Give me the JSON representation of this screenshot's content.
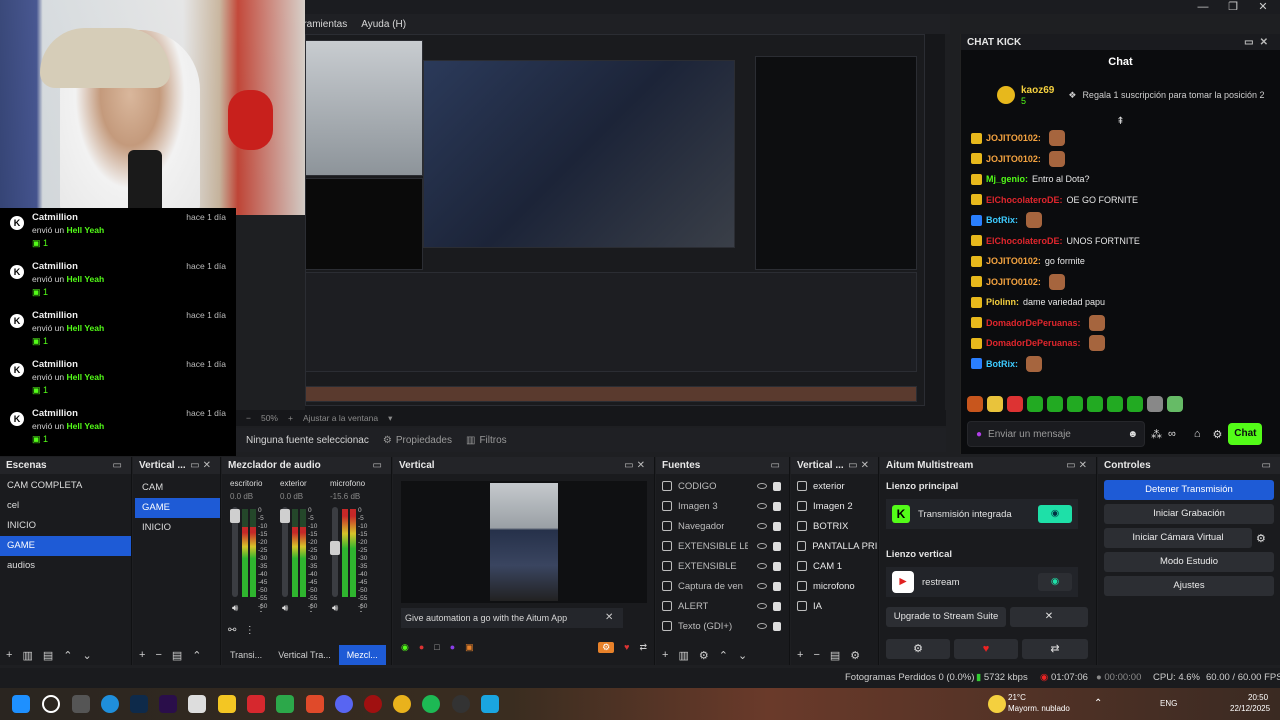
{
  "menu": {
    "tools": "rramientas",
    "help": "Ayuda (H)"
  },
  "window_controls": [
    "—",
    "❐",
    "✕"
  ],
  "preview": {
    "zoom": "50%",
    "fit": "Ajustar a la ventana",
    "no_source": "Ninguna fuente seleccionac",
    "properties": "Propiedades",
    "filters": "Filtros"
  },
  "feed": {
    "items": [
      {
        "name": "Catmillion",
        "time": "hace 1 día",
        "text": "envió un",
        "gift": "Hell Yeah",
        "count": "1"
      },
      {
        "name": "Catmillion",
        "time": "hace 1 día",
        "text": "envió un",
        "gift": "Hell Yeah",
        "count": "1"
      },
      {
        "name": "Catmillion",
        "time": "hace 1 día",
        "text": "envió un",
        "gift": "Hell Yeah",
        "count": "1"
      },
      {
        "name": "Catmillion",
        "time": "hace 1 día",
        "text": "envió un",
        "gift": "Hell Yeah",
        "count": "1"
      },
      {
        "name": "Catmillion",
        "time": "hace 1 día",
        "text": "envió un",
        "gift": "Hell Yeah",
        "count": "1"
      }
    ]
  },
  "chat": {
    "dock_title": "CHAT KICK",
    "title": "Chat",
    "pinned_user": "kaoz69",
    "pinned_count": "5",
    "pinned_text": "Regala 1 suscripción para tomar la posición 2",
    "messages": [
      {
        "user": "JOJITO0102:",
        "text": "",
        "color": "#f4a340",
        "emote": true
      },
      {
        "user": "JOJITO0102:",
        "text": "",
        "color": "#f4a340",
        "emote": true
      },
      {
        "user": "Mj_genio:",
        "text": "Entro al Dota?",
        "color": "#53fc18",
        "emote": false
      },
      {
        "user": "ElChocolateroDE:",
        "text": "OE GO FORNITE",
        "color": "#e0262d",
        "emote": false
      },
      {
        "user": "BotRix:",
        "text": "",
        "color": "#3ecbff",
        "emote": true
      },
      {
        "user": "ElChocolateroDE:",
        "text": "UNOS FORTNITE",
        "color": "#e0262d",
        "emote": false
      },
      {
        "user": "JOJITO0102:",
        "text": "go formite",
        "color": "#f4a340",
        "emote": false
      },
      {
        "user": "JOJITO0102:",
        "text": "",
        "color": "#f4a340",
        "emote": true
      },
      {
        "user": "Piolinn:",
        "text": "dame variedad papu",
        "color": "#f4d03f",
        "emote": false
      },
      {
        "user": "DomadorDePeruanas:",
        "text": "",
        "color": "#e0262d",
        "emote": true
      },
      {
        "user": "DomadorDePeruanas:",
        "text": "",
        "color": "#e0262d",
        "emote": true
      },
      {
        "user": "BotRix:",
        "text": "",
        "color": "#3ecbff",
        "emote": true
      }
    ],
    "input_placeholder": "Enviar un mensaje",
    "send_label": "Chat"
  },
  "scenes": {
    "title": "Escenas",
    "items": [
      "CAM COMPLETA",
      "cel",
      "INICIO",
      "GAME",
      "audios"
    ],
    "selected": 3
  },
  "vertical_scenes": {
    "title": "Vertical ...",
    "items": [
      "CAM",
      "GAME",
      "INICIO"
    ],
    "selected": 1
  },
  "mixer": {
    "title": "Mezclador de audio",
    "channels": [
      {
        "name": "escritorio",
        "db": "0.0 dB"
      },
      {
        "name": "exterior",
        "db": "0.0 dB"
      },
      {
        "name": "microfono",
        "db": "-15.6 dB"
      }
    ],
    "scale": [
      "0",
      "-5",
      "-10",
      "-15",
      "-20",
      "-25",
      "-30",
      "-35",
      "-40",
      "-45",
      "-50",
      "-55",
      "-60"
    ],
    "tabs": [
      "Transi...",
      "Vertical Tra...",
      "Mezcl..."
    ]
  },
  "vertical_preview": {
    "title": "Vertical",
    "banner": "Give automation a go with the Aitum App"
  },
  "sources": {
    "title": "Fuentes",
    "items": [
      "CODIGO",
      "Imagen 3",
      "Navegador",
      "EXTENSIBLE LE",
      "EXTENSIBLE",
      "Captura de ven",
      "ALERT",
      "Texto (GDI+)"
    ]
  },
  "vertical_sources": {
    "title": "Vertical ...",
    "items": [
      "exterior",
      "Imagen 2",
      "BOTRIX",
      "PANTALLA PRIN",
      "CAM 1",
      "microfono",
      "IA"
    ]
  },
  "aitum": {
    "title": "Aitum Multistream",
    "main_canvas": "Lienzo principal",
    "main_output": "Transmisión integrada",
    "vertical_canvas": "Lienzo vertical",
    "vertical_output": "restream",
    "upgrade": "Upgrade to Stream Suite"
  },
  "controls": {
    "title": "Controles",
    "buttons": [
      "Detener Transmisión",
      "Iniciar Grabación",
      "Iniciar Cámara Virtual",
      "Modo Estudio",
      "Ajustes"
    ]
  },
  "status": {
    "dropped": "Fotogramas Perdidos 0 (0.0%)",
    "bitrate": "5732 kbps",
    "live_time": "01:07:06",
    "rec_time": "00:00:00",
    "cpu": "CPU: 4.6%",
    "fps": "60.00 / 60.00 FPS"
  },
  "taskbar": {
    "weather_temp": "21°C",
    "weather_text": "Mayorm. nublado",
    "lang": "ENG",
    "time": "20:50",
    "date": "22/12/2025"
  },
  "colors": {
    "accent": "#1e5bd6",
    "kick_green": "#53fc18"
  }
}
